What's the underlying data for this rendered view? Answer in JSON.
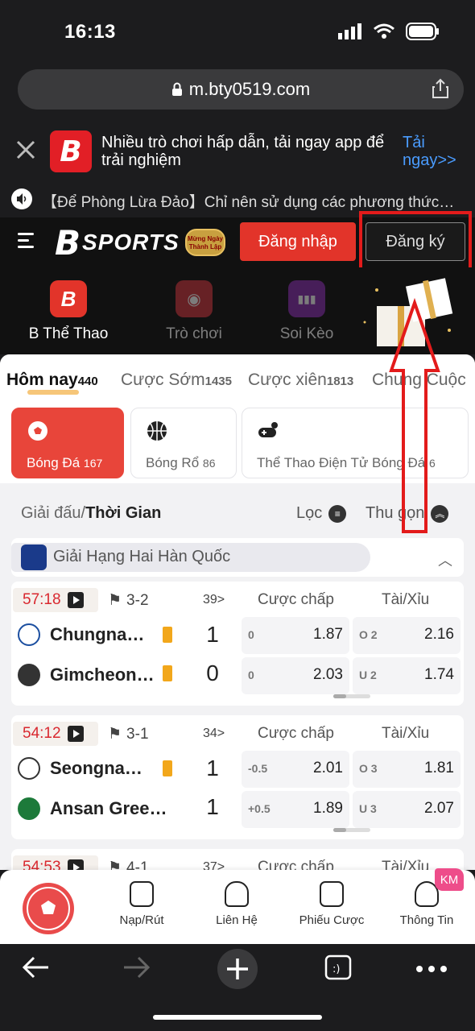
{
  "status": {
    "time": "16:13"
  },
  "browser": {
    "url": "m.bty0519.com"
  },
  "promo": {
    "text": "Nhiều trò chơi hấp dẫn, tải ngay app để trải nghiệm",
    "cta": "Tải ngay>>",
    "logo": "B"
  },
  "marquee": {
    "text": "【Để Phòng Lừa Đảo】Chỉ nên sử dụng các phương thức…"
  },
  "header": {
    "brand_b": "B",
    "brand_sports": "SPORTS",
    "badge": "Mừng Ngày Thành Lập",
    "login": "Đăng nhập",
    "register": "Đăng ký"
  },
  "nav": [
    {
      "label": "B Thể Thao",
      "glyph": "B",
      "color": "#e2342a"
    },
    {
      "label": "Trò chơi",
      "glyph": "◉",
      "color": "#d0353f"
    },
    {
      "label": "Soi Kèo",
      "glyph": "▮▮▮",
      "color": "#8a2fb0"
    }
  ],
  "tabs": [
    {
      "label": "Hôm nay",
      "count": "440"
    },
    {
      "label": "Cược Sớm",
      "count": "1435"
    },
    {
      "label": "Cược xiên",
      "count": "1813"
    },
    {
      "label": "Chung Cuộc",
      "count": ""
    }
  ],
  "sports": [
    {
      "label": "Bóng Đá",
      "count": "167",
      "icon": "soccer-ball-icon"
    },
    {
      "label": "Bóng Rổ",
      "count": "86",
      "icon": "basketball-icon"
    },
    {
      "label": "Thể Thao Điện Tử Bóng Đá",
      "count": "6",
      "icon": "gamepad-icon"
    }
  ],
  "filter": {
    "left_a": "Giải đấu/",
    "left_b": "Thời Gian",
    "loc": "Lọc",
    "collapse": "Thu gọn"
  },
  "league": {
    "name": "Giải Hạng Hai Hàn Quốc",
    "logo_text": "K LEAGUE 2"
  },
  "matches": [
    {
      "time": "57:18",
      "corner": "3-2",
      "more": "39>",
      "h1": "Cược chấp",
      "h2": "Tài/Xỉu",
      "home": {
        "name": "Chungna…",
        "score": "1",
        "hc_line": "0",
        "hc_odd": "1.87",
        "ou_line": "O 2",
        "ou_odd": "2.16",
        "card": true
      },
      "away": {
        "name": "Gimcheon…",
        "score": "0",
        "hc_line": "0",
        "hc_odd": "2.03",
        "ou_line": "U 2",
        "ou_odd": "1.74",
        "card": true
      }
    },
    {
      "time": "54:12",
      "corner": "3-1",
      "more": "34>",
      "h1": "Cược chấp",
      "h2": "Tài/Xỉu",
      "home": {
        "name": "Seongna…",
        "score": "1",
        "hc_line": "-0.5",
        "hc_odd": "2.01",
        "ou_line": "O 3",
        "ou_odd": "1.81",
        "card": true
      },
      "away": {
        "name": "Ansan Gree…",
        "score": "1",
        "hc_line": "+0.5",
        "hc_odd": "1.89",
        "ou_line": "U 3",
        "ou_odd": "2.07",
        "card": false
      }
    },
    {
      "time": "54:53",
      "corner": "4-1",
      "more": "37>",
      "h1": "Cược chấp",
      "h2": "Tài/Xỉu"
    }
  ],
  "tabbar": [
    {
      "label": "Nạp/Rút",
      "icon": "wallet-icon"
    },
    {
      "label": "Liên Hệ",
      "icon": "support-icon"
    },
    {
      "label": "Phiếu Cược",
      "icon": "betslip-icon"
    },
    {
      "label": "Thông Tin",
      "icon": "profile-icon"
    }
  ],
  "km_badge": "KM",
  "colors": {
    "accent_red": "#e2342a",
    "link_blue": "#4a9cff",
    "card_yellow": "#f2a71b"
  }
}
